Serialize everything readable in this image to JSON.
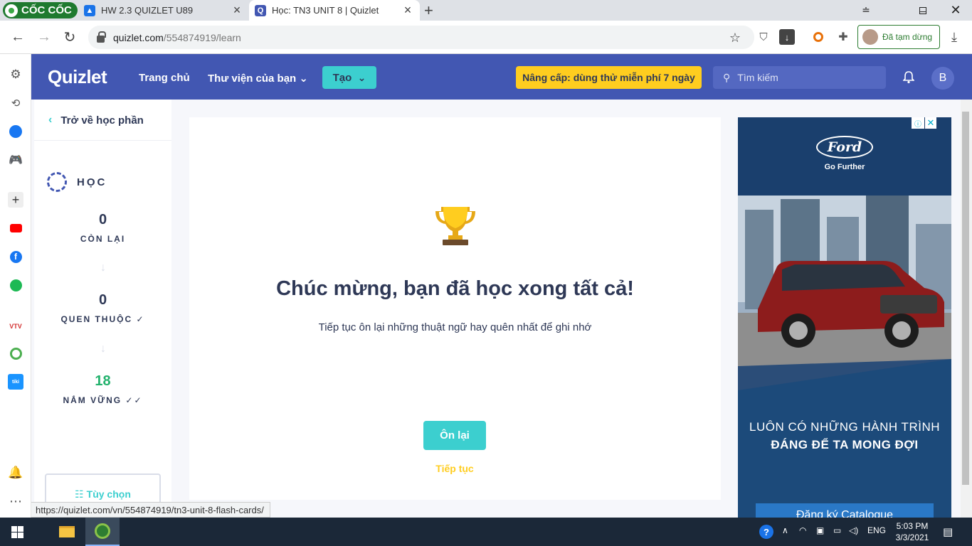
{
  "browser": {
    "brand": "CỐC CỐC",
    "tabs": [
      {
        "title": "HW 2.3 QUIZLET U89",
        "active": false
      },
      {
        "title": "Học: TN3 UNIT 8 | Quizlet",
        "active": true
      }
    ],
    "url_host": "quizlet.com",
    "url_path": "/554874919/learn",
    "profile_status": "Đã tạm dừng",
    "status_url": "https://quizlet.com/vn/554874919/tn3-unit-8-flash-cards/"
  },
  "quizlet_header": {
    "logo": "Quizlet",
    "home": "Trang chủ",
    "library": "Thư viện của bạn",
    "create": "Tạo",
    "upgrade": "Nâng cấp: dùng thử miễn phí 7 ngày",
    "search_placeholder": "Tìm kiếm",
    "avatar_letter": "B"
  },
  "sidebar": {
    "back": "Trở về học phần",
    "mode": "HỌC",
    "stats": [
      {
        "value": "0",
        "label": "CÒN LẠI",
        "check": ""
      },
      {
        "value": "0",
        "label": "QUEN THUỘC",
        "check": "✓"
      },
      {
        "value": "18",
        "label": "NẮM VỮNG",
        "check": "✓✓"
      }
    ],
    "options": "Tùy chọn"
  },
  "main": {
    "title": "Chúc mừng, bạn đã học xong tất cả!",
    "subtitle": "Tiếp tục ôn lại những thuật ngữ hay quên nhất để ghi nhớ",
    "review_button": "Ôn lại",
    "continue_link": "Tiếp tục"
  },
  "ad": {
    "brand": "Ford",
    "tagline": "Go Further",
    "line1": "LUÔN CÓ  NHỮNG HÀNH TRÌNH",
    "line2": "ĐÁNG ĐỂ TA MONG ĐỢI",
    "cta": "Đăng ký Catalogue"
  },
  "taskbar": {
    "lang": "ENG",
    "time": "5:03 PM",
    "date": "3/3/2021"
  },
  "colors": {
    "quizlet_blue": "#4257b2",
    "teal": "#3ccfcf",
    "yellow": "#ffcd1f",
    "mastered_green": "#23b26d"
  }
}
